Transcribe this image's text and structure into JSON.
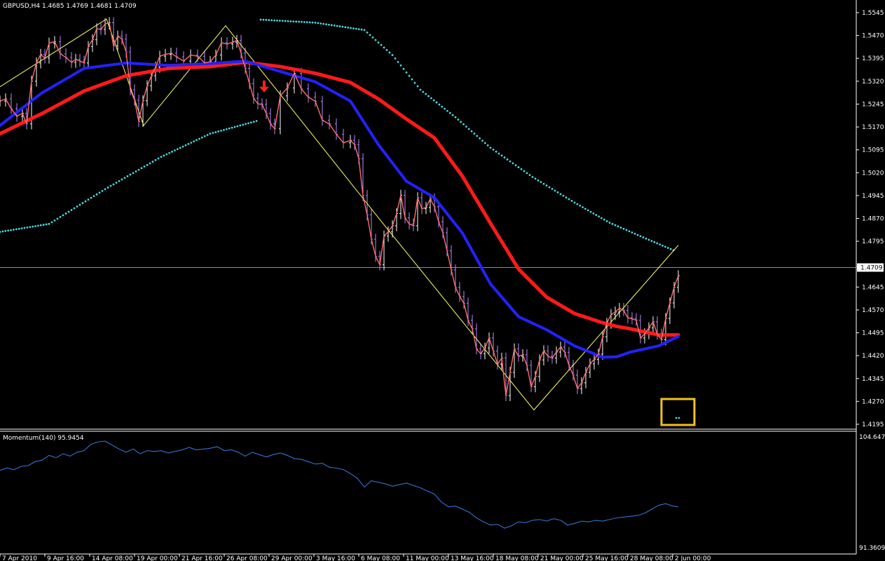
{
  "header": {
    "symbol_line": "GBPUSD,H4  1.4685 1.4769 1.4681 1.4709"
  },
  "colors": {
    "background": "#000000",
    "axis": "#ffffff",
    "bull_bar": "#ffffff",
    "bear_bar": "#b58cff",
    "price_line": "#ff6b6b",
    "ma_fast": "#2222ff",
    "ma_slow": "#ff1a1a",
    "dotted_band": "#49d9e0",
    "zigzag": "#ffff66",
    "momentum": "#3a7ee8",
    "highlight_box": "#f2c21a",
    "arrow": "#ff2020"
  },
  "chart_data": [
    {
      "type": "line",
      "title": "GBPUSD,H4",
      "ohlc_header": {
        "open": 1.4685,
        "high": 1.4769,
        "low": 1.4681,
        "close": 1.4709
      },
      "ylim": [
        1.4195,
        1.5545
      ],
      "y_ticks": [
        "1.5545",
        "1.5470",
        "1.5395",
        "1.5320",
        "1.5245",
        "1.5170",
        "1.5095",
        "1.5020",
        "1.4945",
        "1.4870",
        "1.4795",
        "1.4709",
        "1.4645",
        "1.4570",
        "1.4495",
        "1.4420",
        "1.4345",
        "1.4270",
        "1.4195"
      ],
      "current_price": 1.4709,
      "x_ticks": [
        "7 Apr 2010",
        "9 Apr 16:00",
        "14 Apr 08:00",
        "19 Apr 00:00",
        "21 Apr 16:00",
        "26 Apr 08:00",
        "29 Apr 00:00",
        "3 May 16:00",
        "6 May 08:00",
        "11 May 00:00",
        "13 May 16:00",
        "18 May 08:00",
        "21 May 00:00",
        "25 May 16:00",
        "28 May 08:00",
        "2 Jun 00:00"
      ],
      "series": [
        {
          "values_x": [
            0,
            8,
            16,
            24,
            32,
            38,
            45,
            52,
            58,
            64,
            70,
            78,
            86,
            94,
            102,
            108,
            114,
            120,
            126,
            132,
            138,
            144,
            150,
            156,
            162,
            168,
            174,
            180,
            186,
            192,
            198,
            204,
            210,
            216,
            222,
            228,
            236,
            244,
            252,
            262,
            272,
            282,
            292,
            300,
            308,
            316,
            324,
            332,
            338,
            344,
            350,
            356,
            362,
            368,
            374,
            380,
            386,
            392,
            400,
            410,
            420,
            430,
            440,
            450,
            460,
            470,
            480,
            490,
            500,
            506,
            512,
            518,
            524,
            530,
            536,
            542,
            548,
            554,
            560,
            566,
            572,
            578,
            584,
            590,
            596,
            602,
            608,
            614,
            620,
            626,
            632,
            638,
            644,
            650,
            656,
            662,
            668,
            674,
            680,
            686,
            692,
            698,
            704,
            710,
            716,
            722,
            728,
            734,
            740,
            746,
            752,
            758,
            764,
            770,
            776,
            782,
            788,
            794,
            800,
            806,
            812,
            818,
            824,
            830,
            836,
            842,
            848,
            854,
            860,
            866,
            872,
            878,
            884,
            890,
            896,
            902,
            908,
            914,
            920,
            926,
            932,
            938,
            944,
            950,
            956,
            962,
            968
          ],
          "values": [
            1.5255,
            1.5262,
            1.523,
            1.5205,
            1.5215,
            1.518,
            1.532,
            1.538,
            1.5408,
            1.5396,
            1.5445,
            1.545,
            1.541,
            1.5398,
            1.5382,
            1.5392,
            1.5386,
            1.538,
            1.5434,
            1.5456,
            1.5492,
            1.549,
            1.5508,
            1.5512,
            1.5436,
            1.5468,
            1.5458,
            1.5416,
            1.5292,
            1.5258,
            1.5188,
            1.5256,
            1.5305,
            1.5338,
            1.5366,
            1.5402,
            1.5408,
            1.5412,
            1.54,
            1.5386,
            1.5406,
            1.5402,
            1.538,
            1.5384,
            1.5406,
            1.5446,
            1.5442,
            1.5448,
            1.5454,
            1.5412,
            1.5362,
            1.5312,
            1.5264,
            1.5246,
            1.5244,
            1.5214,
            1.518,
            1.5164,
            1.5272,
            1.5298,
            1.5346,
            1.5295,
            1.5268,
            1.5254,
            1.5192,
            1.518,
            1.5146,
            1.5118,
            1.5126,
            1.5112,
            1.5066,
            1.4945,
            1.4882,
            1.4802,
            1.4746,
            1.4718,
            1.4812,
            1.4826,
            1.4846,
            1.4886,
            1.4946,
            1.4872,
            1.4852,
            1.4846,
            1.4938,
            1.4902,
            1.4906,
            1.4934,
            1.4908,
            1.4859,
            1.4823,
            1.4764,
            1.4701,
            1.4644,
            1.4614,
            1.4592,
            1.4536,
            1.4508,
            1.4442,
            1.4426,
            1.4445,
            1.4478,
            1.4435,
            1.4392,
            1.4412,
            1.4289,
            1.4365,
            1.4442,
            1.4418,
            1.4423,
            1.4388,
            1.4318,
            1.4352,
            1.4406,
            1.4436,
            1.4418,
            1.4412,
            1.4432,
            1.4448,
            1.4431,
            1.4388,
            1.4356,
            1.4312,
            1.4331,
            1.4365,
            1.4393,
            1.4408,
            1.4425,
            1.4482,
            1.4526,
            1.4555,
            1.4563,
            1.4575,
            1.4568,
            1.4544,
            1.4541,
            1.4536,
            1.4478,
            1.4492,
            1.4511,
            1.4531,
            1.4491,
            1.4472,
            1.4542,
            1.4593,
            1.4644,
            1.4682
          ]
        },
        {
          "name": "",
          "values_x": [
            0,
            60,
            120,
            180,
            240,
            300,
            350,
            400,
            450,
            500,
            540,
            580,
            620,
            660,
            700,
            740,
            780,
            820,
            860,
            880,
            900,
            920,
            940,
            968
          ],
          "values": [
            1.5175,
            1.5282,
            1.5362,
            1.538,
            1.5372,
            1.5378,
            1.5386,
            1.5352,
            1.5318,
            1.5255,
            1.5112,
            1.4992,
            1.4938,
            1.4822,
            1.4655,
            1.4548,
            1.4505,
            1.4452,
            1.4415,
            1.4416,
            1.4432,
            1.4442,
            1.4452,
            1.4483
          ]
        },
        {
          "name": "",
          "values_x": [
            0,
            60,
            120,
            180,
            240,
            300,
            350,
            400,
            450,
            500,
            540,
            580,
            620,
            660,
            700,
            740,
            780,
            820,
            860,
            880,
            900,
            920,
            940,
            968
          ],
          "values": [
            1.5148,
            1.5214,
            1.5288,
            1.5338,
            1.5362,
            1.5368,
            1.5382,
            1.5368,
            1.5346,
            1.5316,
            1.5262,
            1.5196,
            1.5134,
            1.5008,
            1.4854,
            1.4704,
            1.4612,
            1.4558,
            1.4528,
            1.4516,
            1.4508,
            1.4498,
            1.4488,
            1.4488
          ]
        }
      ],
      "dotted_band": {
        "lower_x": [
          0,
          70,
          150,
          230,
          300,
          370
        ],
        "lower": [
          1.4826,
          1.4852,
          1.4966,
          1.5072,
          1.5148,
          1.5192
        ],
        "upper_x": [
          372,
          450,
          520,
          560,
          600,
          650,
          700,
          760,
          820,
          870,
          930,
          965
        ],
        "upper": [
          1.5522,
          1.5512,
          1.5488,
          1.5406,
          1.5292,
          1.5202,
          1.5102,
          1.5006,
          1.4922,
          1.4856,
          1.4796,
          1.4762
        ]
      },
      "zigzag": {
        "x": [
          0,
          152,
          205,
          322,
          545,
          762,
          968
        ],
        "values": [
          1.5302,
          1.5524,
          1.5175,
          1.5502,
          1.4858,
          1.4242,
          1.4782
        ]
      }
    },
    {
      "type": "line",
      "title": "Momentum(140) 95.9454",
      "ylim": [
        91.3609,
        104.6476
      ],
      "y_ticks": [
        "104.6476",
        "91.3609"
      ],
      "series": [
        {
          "values_x": [
            0,
            10,
            20,
            30,
            40,
            50,
            60,
            70,
            80,
            90,
            100,
            110,
            120,
            130,
            140,
            150,
            160,
            170,
            180,
            190,
            200,
            210,
            220,
            230,
            240,
            250,
            260,
            270,
            280,
            290,
            300,
            310,
            320,
            330,
            340,
            350,
            360,
            370,
            380,
            390,
            400,
            410,
            420,
            430,
            440,
            450,
            460,
            470,
            480,
            490,
            500,
            510,
            520,
            530,
            540,
            550,
            560,
            570,
            580,
            590,
            600,
            610,
            620,
            630,
            640,
            650,
            660,
            670,
            680,
            690,
            700,
            710,
            720,
            730,
            740,
            750,
            760,
            770,
            780,
            790,
            800,
            810,
            820,
            830,
            840,
            850,
            860,
            870,
            880,
            890,
            900,
            910,
            920,
            930,
            940,
            950,
            960,
            968
          ],
          "values": [
            100.5,
            100.8,
            100.6,
            101.0,
            101.1,
            101.6,
            101.8,
            102.4,
            102.1,
            102.6,
            102.3,
            102.8,
            103.0,
            103.8,
            104.1,
            104.2,
            103.7,
            103.2,
            102.8,
            103.2,
            102.6,
            103.0,
            102.9,
            103.0,
            102.7,
            102.9,
            103.1,
            103.4,
            103.1,
            103.2,
            103.3,
            103.5,
            103.0,
            103.1,
            102.8,
            102.3,
            102.8,
            102.5,
            102.2,
            102.5,
            102.7,
            102.4,
            102.0,
            101.9,
            101.6,
            101.3,
            101.4,
            100.9,
            100.8,
            100.6,
            100.1,
            99.5,
            98.4,
            99.2,
            99.0,
            98.8,
            98.5,
            98.7,
            98.9,
            98.6,
            98.3,
            97.9,
            97.5,
            96.5,
            95.9,
            96.0,
            95.6,
            95.2,
            94.5,
            94.0,
            93.6,
            93.7,
            93.2,
            93.5,
            94.0,
            93.9,
            94.2,
            94.3,
            94.1,
            94.4,
            94.2,
            93.6,
            93.8,
            94.1,
            94.0,
            94.2,
            94.1,
            94.3,
            94.5,
            94.6,
            94.7,
            94.8,
            95.1,
            95.6,
            96.1,
            96.3,
            96.0,
            95.9
          ]
        }
      ]
    }
  ]
}
